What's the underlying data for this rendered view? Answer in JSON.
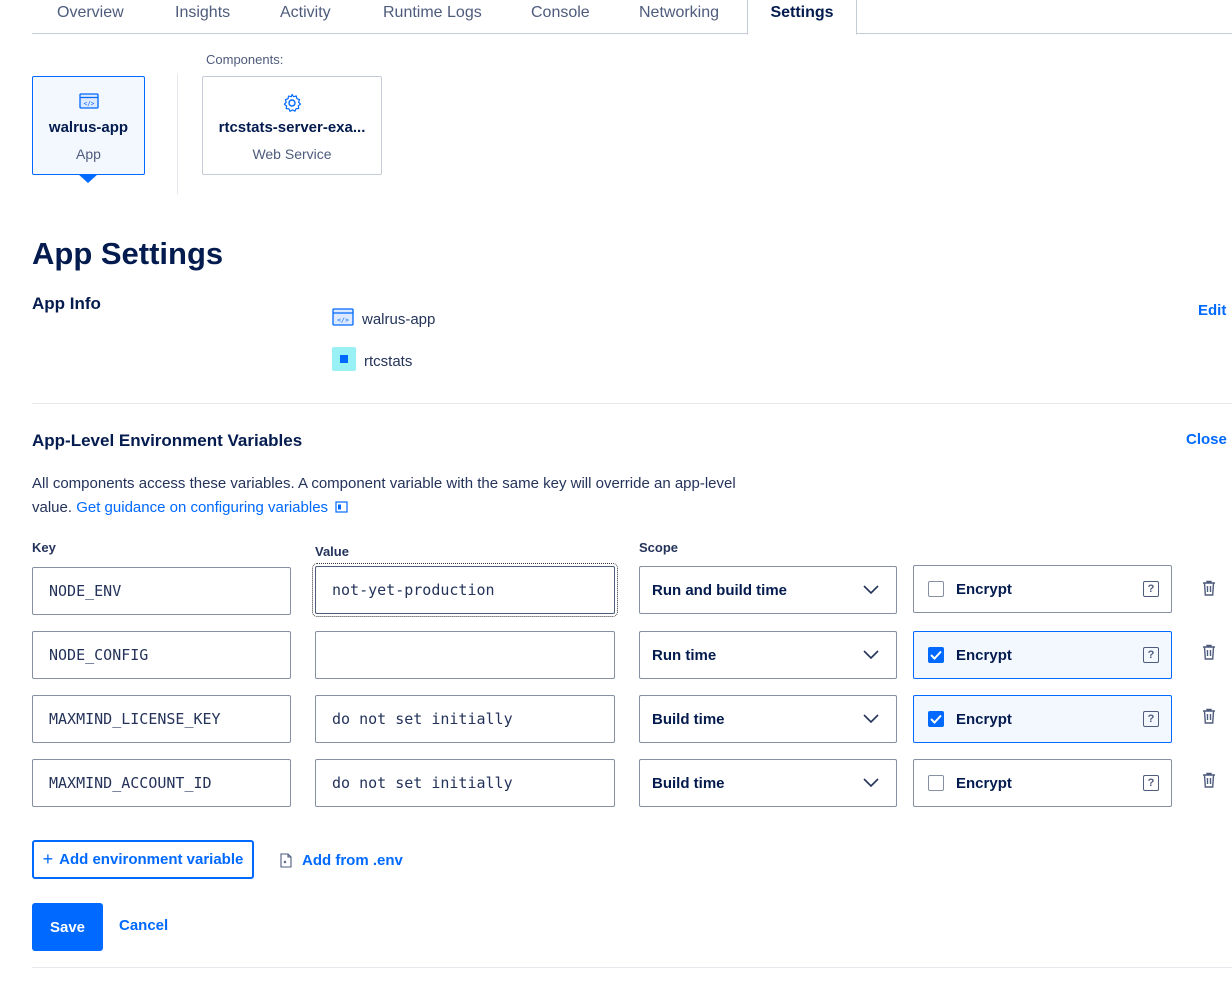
{
  "tabs": [
    {
      "label": "Overview"
    },
    {
      "label": "Insights"
    },
    {
      "label": "Activity"
    },
    {
      "label": "Runtime Logs"
    },
    {
      "label": "Console"
    },
    {
      "label": "Networking"
    },
    {
      "label": "Settings",
      "active": true
    }
  ],
  "components": {
    "label": "Components:",
    "app_card": {
      "name": "walrus-app",
      "type": "App",
      "icon": "app-code-icon"
    },
    "service_card": {
      "name": "rtcstats-server-exa...",
      "type": "Web Service",
      "icon": "gear-icon"
    }
  },
  "page_title": "App Settings",
  "app_info": {
    "title": "App Info",
    "edit_label": "Edit",
    "app_name": "walrus-app",
    "project_name": "rtcstats",
    "project_color": "#99f0f5",
    "project_square_color": "#0069ff"
  },
  "env_section": {
    "title": "App-Level Environment Variables",
    "close_label": "Close",
    "description": "All components access these variables. A component variable with the same key will override an app-level value.",
    "guidance_link": "Get guidance on configuring variables",
    "col_key": "Key",
    "col_value": "Value",
    "col_scope": "Scope",
    "encrypt_label": "Encrypt",
    "help_label": "?",
    "rows": [
      {
        "key": "NODE_ENV",
        "value": "not-yet-production",
        "scope": "Run and build time",
        "encrypt": false
      },
      {
        "key": "NODE_CONFIG",
        "value": "",
        "scope": "Run time",
        "encrypt": true
      },
      {
        "key": "MAXMIND_LICENSE_KEY",
        "value": "do not set initially",
        "scope": "Build time",
        "encrypt": true
      },
      {
        "key": "MAXMIND_ACCOUNT_ID",
        "value": "do not set initially",
        "scope": "Build time",
        "encrypt": false
      }
    ],
    "add_variable_label": "Add environment variable",
    "add_from_env_label": "Add from .env"
  },
  "actions": {
    "save_label": "Save",
    "cancel_label": "Cancel"
  },
  "colors": {
    "accent": "#0069ff",
    "text": "#031b4e",
    "border": "#8690a2"
  }
}
